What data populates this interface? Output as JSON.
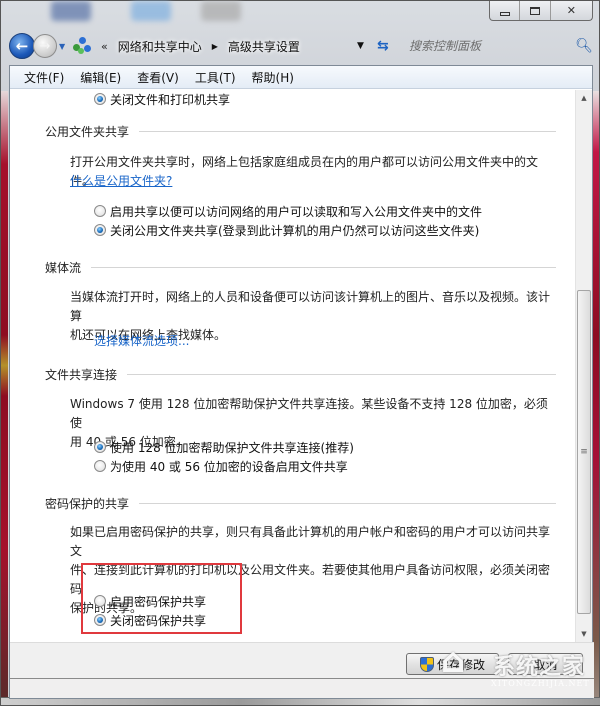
{
  "window": {
    "caption_buttons": {
      "minimize": "minimize",
      "maximize": "maximize",
      "close": "✕"
    }
  },
  "nav": {
    "back_icon": "back-arrow-icon",
    "forward_icon": "forward-arrow-icon",
    "overflow": "«",
    "breadcrumbs": [
      "网络和共享中心",
      "高级共享设置"
    ],
    "search_placeholder": "搜索控制面板"
  },
  "menu": {
    "items": [
      "文件(F)",
      "编辑(E)",
      "查看(V)",
      "工具(T)",
      "帮助(H)"
    ]
  },
  "content": {
    "top_option": {
      "label": "关闭文件和打印机共享",
      "checked": true
    },
    "sections": [
      {
        "title": "公用文件夹共享",
        "description": "打开公用文件夹共享时，网络上包括家庭组成员在内的用户都可以访问公用文件夹中的文件。",
        "link": "什么是公用文件夹?",
        "options": [
          {
            "label": "启用共享以便可以访问网络的用户可以读取和写入公用文件夹中的文件",
            "checked": false
          },
          {
            "label": "关闭公用文件夹共享(登录到此计算机的用户仍然可以访问这些文件夹)",
            "checked": true
          }
        ]
      },
      {
        "title": "媒体流",
        "description_lines": [
          "当媒体流打开时，网络上的人员和设备便可以访问该计算机上的图片、音乐以及视频。该计算",
          "机还可以在网络上查找媒体。"
        ],
        "link": "选择媒体流选项..."
      },
      {
        "title": "文件共享连接",
        "description_lines": [
          "Windows 7 使用 128 位加密帮助保护文件共享连接。某些设备不支持 128 位加密，必须使",
          "用 40 或 56 位加密。"
        ],
        "options": [
          {
            "label": "使用 128 位加密帮助保护文件共享连接(推荐)",
            "checked": true
          },
          {
            "label": "为使用 40 或 56 位加密的设备启用文件共享",
            "checked": false
          }
        ]
      },
      {
        "title": "密码保护的共享",
        "description_lines": [
          "如果已启用密码保护的共享，则只有具备此计算机的用户帐户和密码的用户才可以访问共享文",
          "件、连接到此计算机的打印机以及公用文件夹。若要使其他用户具备访问权限，必须关闭密码",
          "保护的共享。"
        ],
        "options": [
          {
            "label": "启用密码保护共享",
            "checked": false
          },
          {
            "label": "关闭密码保护共享",
            "checked": true
          }
        ]
      }
    ]
  },
  "footer": {
    "save_label": "保存修改",
    "cancel_label": "取消"
  },
  "watermark": {
    "text": "系统之家",
    "sub": "XITONGZHIJIA.NET"
  },
  "colors": {
    "link": "#1a66c9",
    "highlight": "#e0393e"
  }
}
